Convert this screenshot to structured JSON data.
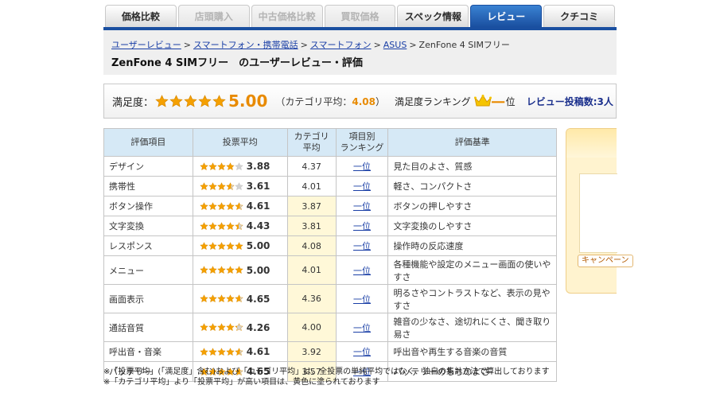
{
  "tabs": [
    {
      "label": "価格比較",
      "state": "normal"
    },
    {
      "label": "店頭購入",
      "state": "disabled"
    },
    {
      "label": "中古価格比較",
      "state": "disabled"
    },
    {
      "label": "買取価格",
      "state": "disabled"
    },
    {
      "label": "スペック情報",
      "state": "normal"
    },
    {
      "label": "レビュー",
      "state": "active"
    },
    {
      "label": "クチコミ",
      "state": "normal"
    }
  ],
  "breadcrumb": {
    "links": [
      "ユーザーレビュー",
      "スマートフォン・携帯電話",
      "スマートフォン",
      "ASUS"
    ],
    "separator": ">",
    "current": "ZenFone 4 SIMフリー"
  },
  "page_title": "ZenFone 4 SIMフリー　のユーザーレビュー・評価",
  "satisfaction": {
    "label": "満足度：",
    "stars": 5.0,
    "score": "5.00",
    "category_avg_prefix": "（カテゴリ平均：",
    "category_avg_value": "4.08",
    "category_avg_suffix": "）",
    "ranking_label": "満足度ランキング",
    "ranking_value": "一",
    "ranking_unit": "位",
    "review_count": "レビュー投稿数:3人"
  },
  "table": {
    "headers": [
      "評価項目",
      "投票平均",
      "カテゴリ\n平均",
      "項目別\nランキング",
      "評価基準"
    ],
    "rows": [
      {
        "item": "デザイン",
        "stars": 3.88,
        "score": "3.88",
        "cat": "4.37",
        "rank": "一位",
        "criteria": "見た目のよさ、質感",
        "highlight": false
      },
      {
        "item": "携帯性",
        "stars": 3.61,
        "score": "3.61",
        "cat": "4.01",
        "rank": "一位",
        "criteria": "軽さ、コンパクトさ",
        "highlight": false
      },
      {
        "item": "ボタン操作",
        "stars": 4.61,
        "score": "4.61",
        "cat": "3.87",
        "rank": "一位",
        "criteria": "ボタンの押しやすさ",
        "highlight": true
      },
      {
        "item": "文字変換",
        "stars": 4.43,
        "score": "4.43",
        "cat": "3.81",
        "rank": "一位",
        "criteria": "文字変換のしやすさ",
        "highlight": true
      },
      {
        "item": "レスポンス",
        "stars": 5.0,
        "score": "5.00",
        "cat": "4.08",
        "rank": "一位",
        "criteria": "操作時の反応速度",
        "highlight": true
      },
      {
        "item": "メニュー",
        "stars": 5.0,
        "score": "5.00",
        "cat": "4.01",
        "rank": "一位",
        "criteria": "各種機能や設定のメニュー画面の使いやすさ",
        "highlight": true
      },
      {
        "item": "画面表示",
        "stars": 4.65,
        "score": "4.65",
        "cat": "4.36",
        "rank": "一位",
        "criteria": "明るさやコントラストなど、表示の見やすさ",
        "highlight": true
      },
      {
        "item": "通話音質",
        "stars": 4.26,
        "score": "4.26",
        "cat": "4.00",
        "rank": "一位",
        "criteria": "雑音の少なさ、途切れにくさ、聞き取り易さ",
        "highlight": true
      },
      {
        "item": "呼出音・音楽",
        "stars": 4.61,
        "score": "4.61",
        "cat": "3.92",
        "rank": "一位",
        "criteria": "呼出音や再生する音楽の音質",
        "highlight": true
      },
      {
        "item": "バッテリー",
        "stars": 4.65,
        "score": "4.65",
        "cat": "3.57",
        "rank": "一位",
        "criteria": "バッテリーのもちのよさ",
        "highlight": true
      }
    ]
  },
  "notes": [
    "※「投票平均」(「満足度」含む)および「カテゴリ平均」は、全投票の単純平均ではなく、独自の集計方法で算出しております",
    "※「カテゴリ平均」より「投票平均」が高い項目は、黄色に塗られております"
  ],
  "side_panel": {
    "button_label": "キャンペーン"
  },
  "colors": {
    "accent": "#1a4fa0",
    "star": "#f5a000",
    "highlight": "#fff8d8",
    "header_bg": "#d6e9f6"
  }
}
